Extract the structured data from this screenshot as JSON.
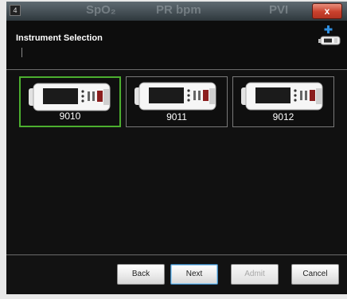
{
  "window": {
    "app_icon_label": "4",
    "close_label": "x",
    "background_text": [
      "SpO₂",
      "PR bpm",
      "PVI"
    ]
  },
  "dialog": {
    "title": "Instrument Selection",
    "add_device_icon": "plus-device-icon"
  },
  "instruments": [
    {
      "label": "9010",
      "selected": true
    },
    {
      "label": "9011",
      "selected": false
    },
    {
      "label": "9012",
      "selected": false
    }
  ],
  "buttons": {
    "back": "Back",
    "next": "Next",
    "admit": "Admit",
    "cancel": "Cancel"
  },
  "colors": {
    "selected_border": "#4caf2f",
    "close_button": "#c8412d",
    "add_icon": "#2f8fe0"
  }
}
